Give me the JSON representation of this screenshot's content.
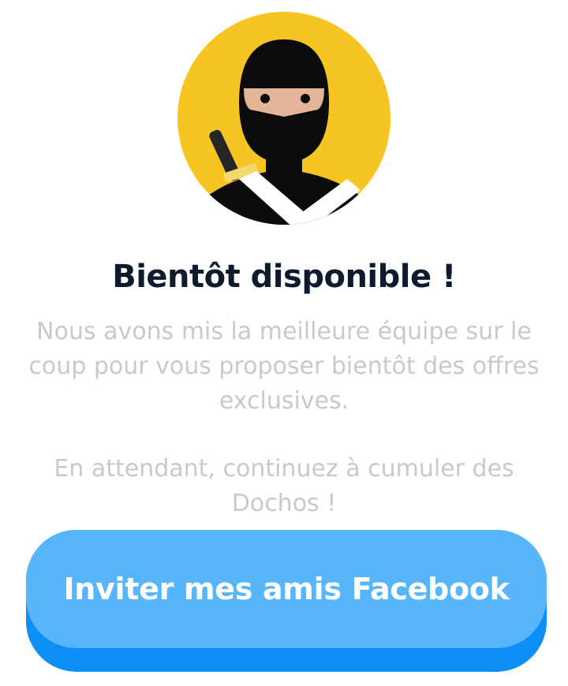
{
  "avatar": {
    "icon": "ninja-icon",
    "background_color": "#f7c521"
  },
  "title": "Bientôt disponible !",
  "message": {
    "paragraph_1": "Nous avons mis la meilleure équipe sur le coup pour vous proposer bientôt des offres exclusives.",
    "paragraph_2": "En attendant, continuez à cumuler des Dochos !"
  },
  "invite_button": {
    "label": "Inviter mes amis Facebook",
    "color": "#57b6fb",
    "shadow_color": "#0e8ff5"
  }
}
